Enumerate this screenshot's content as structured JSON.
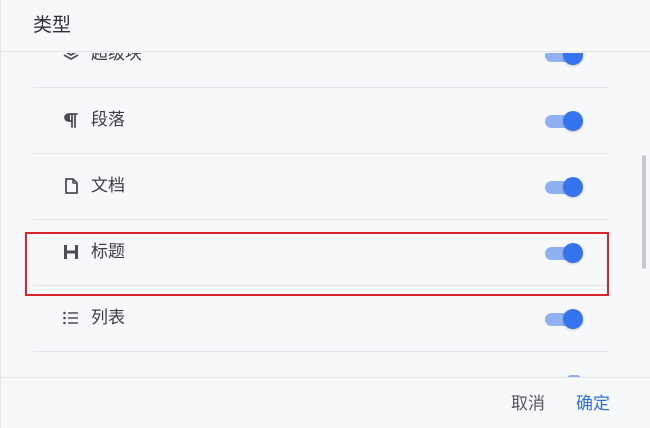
{
  "dialog": {
    "title": "类型"
  },
  "items": [
    {
      "label": "超级块",
      "icon": "superblock-icon",
      "enabled": true
    },
    {
      "label": "段落",
      "icon": "paragraph-icon",
      "enabled": true
    },
    {
      "label": "文档",
      "icon": "document-icon",
      "enabled": true
    },
    {
      "label": "标题",
      "icon": "heading-icon",
      "enabled": true
    },
    {
      "label": "列表",
      "icon": "list-icon",
      "enabled": true
    }
  ],
  "footer": {
    "cancel_label": "取消",
    "ok_label": "确定"
  },
  "colors": {
    "accent": "#3574ee",
    "toggle_track": "#8fb1f2",
    "highlight_box": "#d9262b"
  }
}
